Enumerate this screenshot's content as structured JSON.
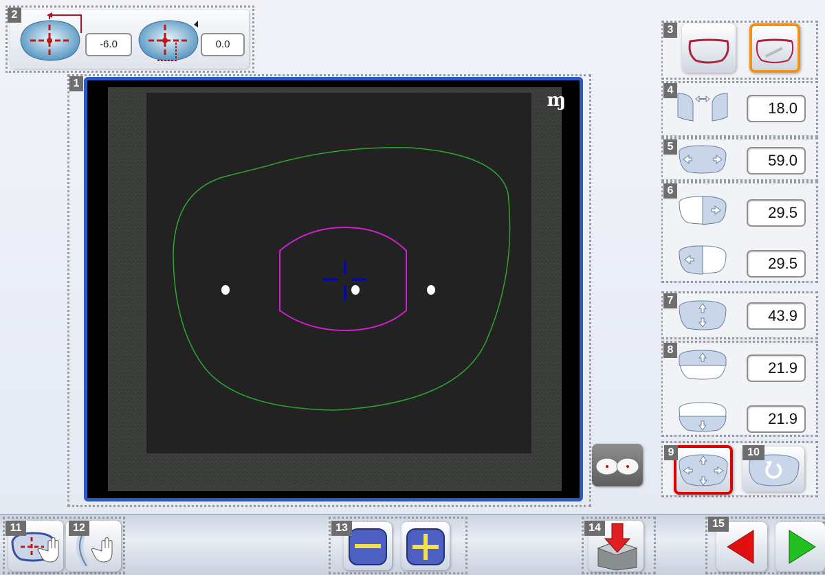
{
  "badges": [
    "1",
    "2",
    "3",
    "4",
    "5",
    "6",
    "7",
    "8",
    "9",
    "10",
    "11",
    "12",
    "13",
    "14",
    "15"
  ],
  "top_panel": {
    "value_a": "-6.0",
    "value_b": "0.0"
  },
  "viewer": {
    "logo_glyph": "ɱ",
    "outline_color": "#2fa52f",
    "inner_outline_color": "#d020d0",
    "crosshair_color": "#0000cc"
  },
  "measurements": {
    "bridge": "18.0",
    "width": "59.0",
    "nasal_half": "29.5",
    "temporal_half": "29.5",
    "height": "43.9",
    "upper_half": "21.9",
    "lower_half": "21.9"
  },
  "colors": {
    "selected_orange": "#f0921a",
    "selected_red": "#dd0000",
    "frame_blue": "#2a5bc0",
    "arrow_red": "#e01010",
    "arrow_green": "#22c020"
  },
  "icons": {
    "zoom_out": "minus-icon",
    "zoom_in": "plus-icon"
  }
}
